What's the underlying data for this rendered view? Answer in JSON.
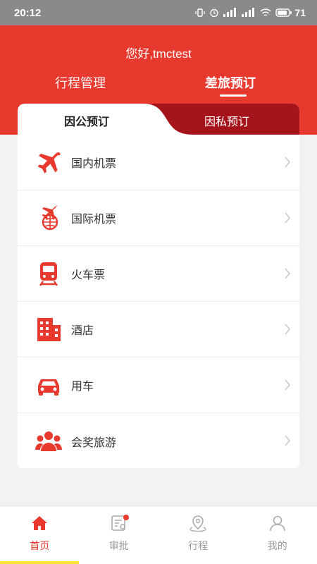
{
  "status_bar": {
    "time": "20:12",
    "battery": "71",
    "icons": [
      "vibrate-icon",
      "alarm-icon",
      "signal-icon",
      "signal-icon",
      "wifi-icon",
      "battery-icon"
    ]
  },
  "header": {
    "greeting": "您好,tmctest",
    "tabs": [
      {
        "label": "行程管理",
        "active": false
      },
      {
        "label": "差旅预订",
        "active": true
      }
    ]
  },
  "booking_tabs": {
    "public_label": "因公预订",
    "private_label": "因私预订",
    "active": "public"
  },
  "menu": [
    {
      "label": "国内机票",
      "icon": "airplane-icon"
    },
    {
      "label": "国际机票",
      "icon": "globe-airplane-icon"
    },
    {
      "label": "火车票",
      "icon": "train-icon"
    },
    {
      "label": "酒店",
      "icon": "hotel-building-icon"
    },
    {
      "label": "用车",
      "icon": "car-icon"
    },
    {
      "label": "会奖旅游",
      "icon": "group-people-icon"
    }
  ],
  "bottom_nav": [
    {
      "label": "首页",
      "icon": "home-icon",
      "active": true
    },
    {
      "label": "审批",
      "icon": "approval-icon",
      "badge": true
    },
    {
      "label": "行程",
      "icon": "trip-location-icon"
    },
    {
      "label": "我的",
      "icon": "profile-icon"
    }
  ],
  "colors": {
    "brand_red": "#e8392e",
    "private_tab_red": "#a5141a",
    "status_bar_gray": "#8a8a8a",
    "inactive_gray": "#999999"
  }
}
